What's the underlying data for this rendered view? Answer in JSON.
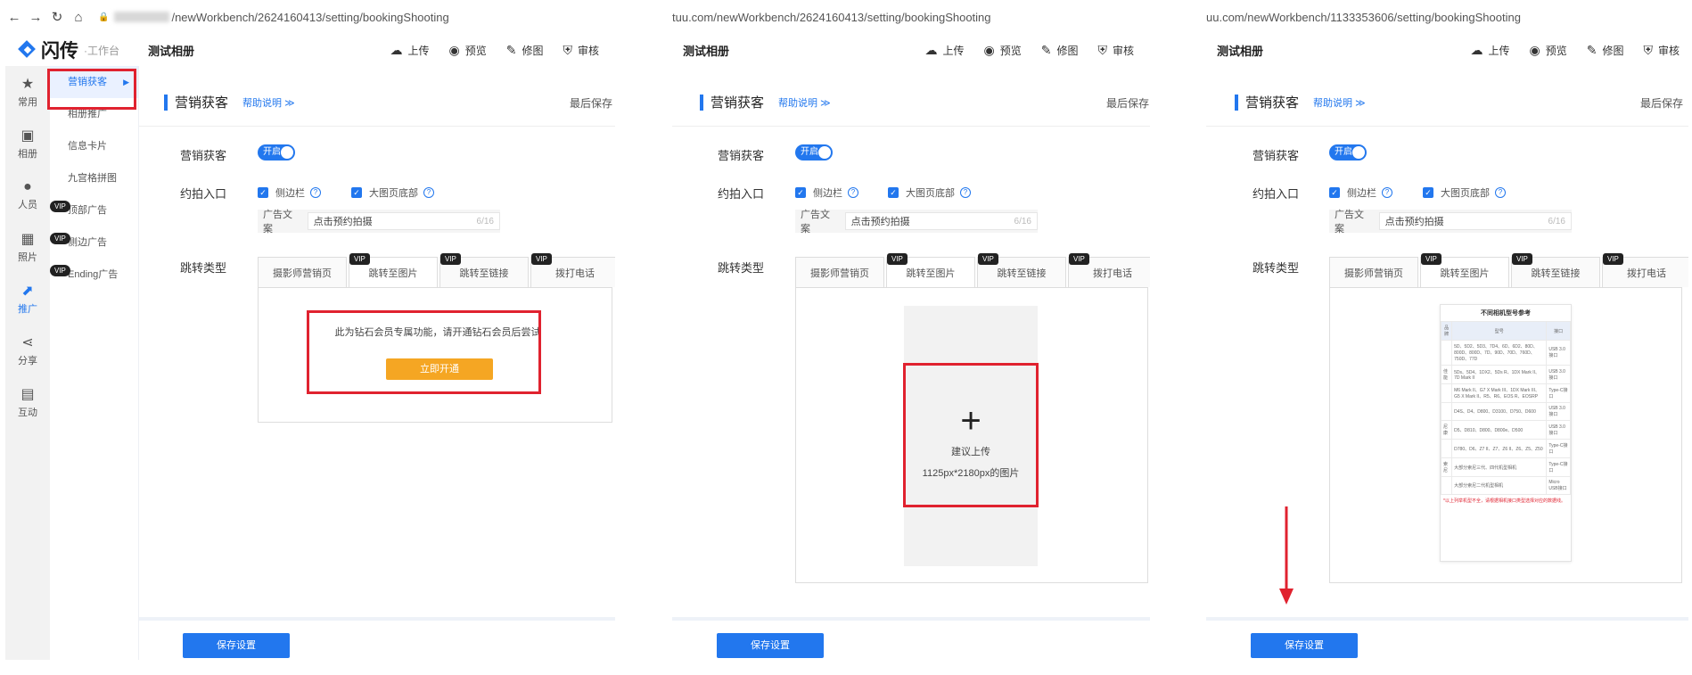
{
  "url": {
    "p1": "/newWorkbench/2624160413/setting/bookingShooting",
    "p2": "tuu.com/newWorkbench/2624160413/setting/bookingShooting",
    "p3": "uu.com/newWorkbench/1133353606/setting/bookingShooting"
  },
  "brand": {
    "name": "闪传",
    "sub": "·工作台"
  },
  "album_title": "测试相册",
  "actions": {
    "upload": "上传",
    "preview": "预览",
    "retouch": "修图",
    "review": "审核"
  },
  "sidebar": [
    {
      "label": "常用",
      "icon": "star-icon"
    },
    {
      "label": "相册",
      "icon": "image-icon"
    },
    {
      "label": "人员",
      "icon": "person-icon"
    },
    {
      "label": "照片",
      "icon": "photo-icon"
    },
    {
      "label": "推广",
      "icon": "trend-icon"
    },
    {
      "label": "分享",
      "icon": "share-icon"
    },
    {
      "label": "互动",
      "icon": "chat-icon"
    }
  ],
  "submenu": [
    "营销获客",
    "相册推广",
    "信息卡片",
    "九宫格拼图",
    "顶部广告",
    "侧边广告",
    "Ending广告"
  ],
  "vip": "VIP",
  "section": {
    "title": "营销获客",
    "help": "帮助说明 ≫",
    "last_save": "最后保存"
  },
  "form": {
    "marketing_label": "营销获客",
    "toggle_text": "开启",
    "entry_label": "约拍入口",
    "cb_sidebar": "侧边栏",
    "cb_bottom": "大图页底部",
    "ad_label": "广告文案",
    "ad_value": "点击预约拍摄",
    "ad_count": "6/16",
    "jump_label": "跳转类型"
  },
  "tabs": [
    "摄影师营销页",
    "跳转至图片",
    "跳转至链接",
    "拨打电话"
  ],
  "notice": "此为钻石会员专属功能，请开通钻石会员后尝试",
  "open_now": "立即开通",
  "upload": {
    "hint": "建议上传",
    "size": "1125px*2180px的图片"
  },
  "save": "保存设置",
  "sample": {
    "title": "不同相机型号参考",
    "head": [
      "品牌",
      "型号",
      "接口"
    ],
    "rows": [
      [
        "",
        "5D、5D2、5D3、7D4、6D、6D2、80D、800D、800D、7D、90D、70D、760D、750D、77D",
        "USB 3.0接口"
      ],
      [
        "佳能",
        "5Ds、5D4、1DX2、5Ds R、1DX Mark II、7D Mark II",
        "USB 3.0接口"
      ],
      [
        "",
        "M6 Mark II、G7 X Mark III、1DX Mark III、G5 X Mark II、R5、R6、EOS R、EOSRP",
        "Type-C接口"
      ],
      [
        "",
        "D4S、D4、D800、D3100、D750、D600",
        "USB 3.0接口"
      ],
      [
        "尼康",
        "D5、D810、D800、D800e、D500",
        "USB 3.0接口"
      ],
      [
        "",
        "D780、D6、Z7 II、Z7、Z6 II、Z6、Z5、Z50",
        "Type-C接口"
      ],
      [
        "索尼",
        "大部分索尼三代、四代机型相机",
        "Type-C接口"
      ],
      [
        "",
        "大部分索尼二代机型相机",
        "Micro USB接口"
      ]
    ],
    "note": "*以上列举机型不全，请根据相机接口类型选择对应的数据线。"
  },
  "colors": {
    "accent": "#2277ee",
    "vip": "#222222",
    "open_btn": "#f5a623",
    "highlight": "#e0222f"
  }
}
